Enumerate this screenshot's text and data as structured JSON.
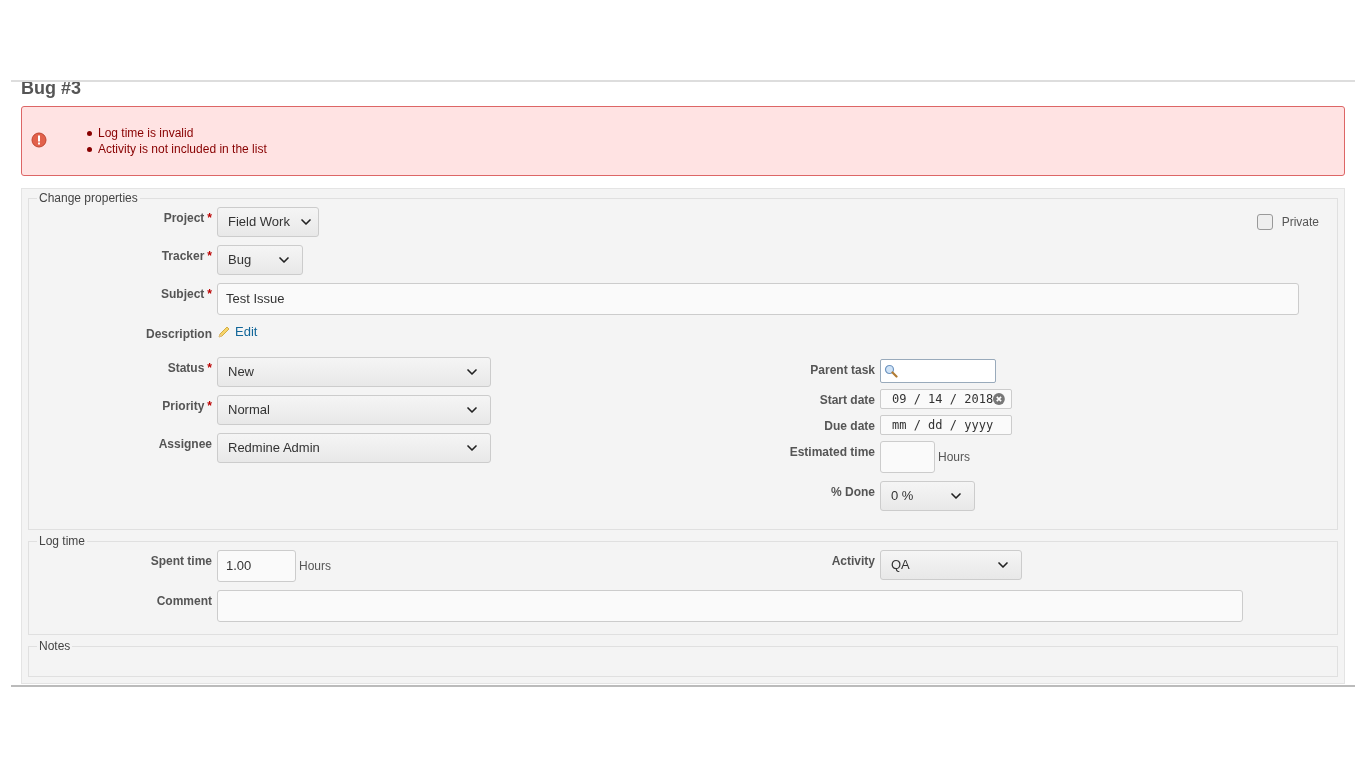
{
  "issue_title": "Bug #3",
  "errors": [
    "Log time is invalid",
    "Activity is not included in the list"
  ],
  "required_mark": "*",
  "change_properties": {
    "legend": "Change properties",
    "private": {
      "label": "Private",
      "checked": false
    },
    "top_fields": [
      {
        "kind": "select",
        "label": "Project",
        "required": true,
        "value": "Field Work"
      },
      {
        "kind": "select",
        "label": "Tracker",
        "required": true,
        "value": "Bug"
      },
      {
        "kind": "text",
        "label": "Subject",
        "required": true,
        "value": "Test Issue"
      },
      {
        "kind": "edit_link",
        "label": "Description",
        "required": false,
        "value": "Edit"
      }
    ],
    "left_fields": [
      {
        "kind": "select",
        "label": "Status",
        "required": true,
        "value": "New"
      },
      {
        "kind": "select",
        "label": "Priority",
        "required": true,
        "value": "Normal"
      },
      {
        "kind": "select",
        "label": "Assignee",
        "required": false,
        "value": "Redmine Admin"
      }
    ],
    "right_fields": [
      {
        "kind": "search",
        "label": "Parent task",
        "required": false
      },
      {
        "kind": "date",
        "label": "Start date",
        "required": false,
        "value": "09 / 14 / 2018",
        "clearable": true
      },
      {
        "kind": "date",
        "label": "Due date",
        "required": false,
        "placeholder": "mm / dd / yyyy",
        "clearable": false
      },
      {
        "kind": "number",
        "label": "Estimated time",
        "required": false,
        "unit": "Hours"
      },
      {
        "kind": "select",
        "label": "% Done",
        "required": false,
        "value": "0 %"
      }
    ]
  },
  "log_time": {
    "legend": "Log time",
    "left_fields": [
      {
        "kind": "number",
        "label": "Spent time",
        "required": false,
        "value": "1.00",
        "unit": "Hours"
      },
      {
        "kind": "text",
        "label": "Comment",
        "required": false
      }
    ],
    "right_fields": [
      {
        "kind": "select",
        "label": "Activity",
        "required": false,
        "value": "QA"
      }
    ]
  },
  "notes": {
    "legend": "Notes"
  }
}
